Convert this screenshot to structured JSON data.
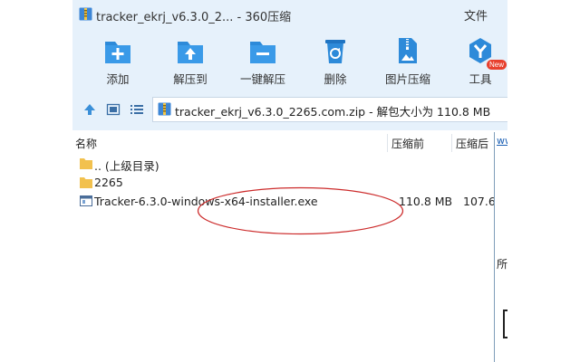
{
  "window": {
    "title": "tracker_ekrj_v6.3.0_2... - 360压缩",
    "menu": {
      "file": "文件"
    }
  },
  "toolbar": {
    "items": [
      {
        "label": "添加",
        "icon": "add-icon"
      },
      {
        "label": "解压到",
        "icon": "extract-to-icon"
      },
      {
        "label": "一键解压",
        "icon": "one-click-extract-icon"
      },
      {
        "label": "删除",
        "icon": "recycle-icon"
      },
      {
        "label": "图片压缩",
        "icon": "image-compress-icon"
      },
      {
        "label": "工具",
        "icon": "tools-icon"
      }
    ],
    "badge": "New"
  },
  "address": {
    "path": "tracker_ekrj_v6.3.0_2265.com.zip - 解包大小为 110.8 MB"
  },
  "columns": {
    "name": "名称",
    "size": "压缩前",
    "compressed": "压缩后"
  },
  "files": [
    {
      "name": ".. (上级目录)",
      "type": "folder",
      "size": "",
      "compressed": ""
    },
    {
      "name": "2265",
      "type": "folder",
      "size": "",
      "compressed": ""
    },
    {
      "name": "Tracker-6.3.0-windows-x64-installer.exe",
      "type": "exe",
      "size": "110.8 MB",
      "compressed": "107.6"
    }
  ],
  "side_panel": {
    "link": "ww",
    "char": "所"
  },
  "colors": {
    "chrome_bg": "#e6f1fb",
    "icon_blue": "#2d8ad9",
    "annotation": "#cc2b2b",
    "badge": "#e8402e"
  }
}
